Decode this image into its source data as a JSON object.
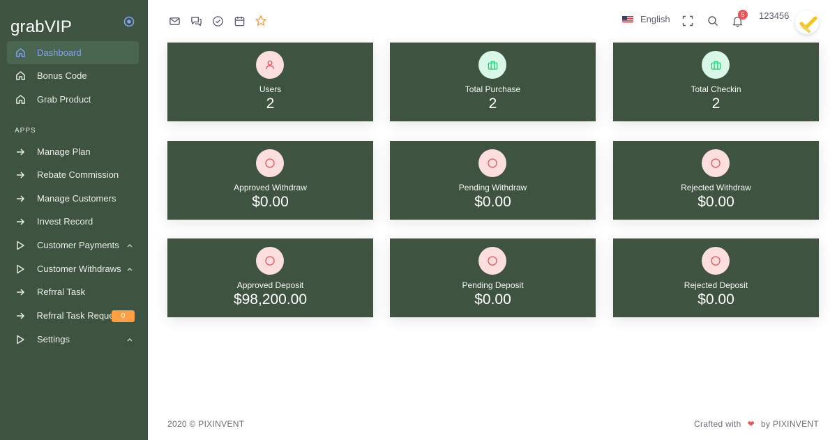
{
  "brand": {
    "name": "grabVIP"
  },
  "sidebar": {
    "section_title": "APPS",
    "items": [
      {
        "label": "Dashboard",
        "active": true
      },
      {
        "label": "Bonus Code"
      },
      {
        "label": "Grab Product"
      },
      {
        "label": "Manage Plan"
      },
      {
        "label": "Rebate Commission"
      },
      {
        "label": "Manage Customers"
      },
      {
        "label": "Invest Record"
      },
      {
        "label": "Customer Payments"
      },
      {
        "label": "Customer Withdraws"
      },
      {
        "label": "Refrral Task"
      },
      {
        "label": "Refrral Task Reque",
        "badge": "0"
      },
      {
        "label": "Settings"
      }
    ]
  },
  "topbar": {
    "shortcut_icons": [
      "mail-icon",
      "chat-icon",
      "check-circle-icon",
      "calendar-icon",
      "star-icon"
    ],
    "language": "English",
    "notification_count": "5",
    "user_name": "123456"
  },
  "cards": [
    {
      "title": "Users",
      "value": "2",
      "icon": "user-icon",
      "icon_color": "#ea5455"
    },
    {
      "title": "Total Purchase",
      "value": "2",
      "icon": "briefcase-icon",
      "icon_color": "#28c76f"
    },
    {
      "title": "Total Checkin",
      "value": "2",
      "icon": "briefcase-icon",
      "icon_color": "#28c76f"
    },
    {
      "title": "Approved Withdraw",
      "value": "$0.00",
      "icon": "circle-icon",
      "icon_color": "#ea5455"
    },
    {
      "title": "Pending Withdraw",
      "value": "$0.00",
      "icon": "circle-icon",
      "icon_color": "#ea5455"
    },
    {
      "title": "Rejected Withdraw",
      "value": "$0.00",
      "icon": "circle-icon",
      "icon_color": "#ea5455"
    },
    {
      "title": "Approved Deposit",
      "value": "$98,200.00",
      "icon": "circle-icon",
      "icon_color": "#ea5455"
    },
    {
      "title": "Pending Deposit",
      "value": "$0.00",
      "icon": "circle-icon",
      "icon_color": "#ea5455"
    },
    {
      "title": "Rejected Deposit",
      "value": "$0.00",
      "icon": "circle-icon",
      "icon_color": "#ea5455"
    }
  ],
  "footer": {
    "copyright": "2020 © PIXINVENT",
    "crafted_prefix": "Crafted with",
    "crafted_suffix": "by PIXINVENT"
  },
  "colors": {
    "sidebar_bg": "#3e5440",
    "card_bg": "#3e5440",
    "active_text": "#7fa2ff",
    "badge_orange": "#ff9f43",
    "danger": "#ea5455",
    "success": "#28c76f"
  }
}
